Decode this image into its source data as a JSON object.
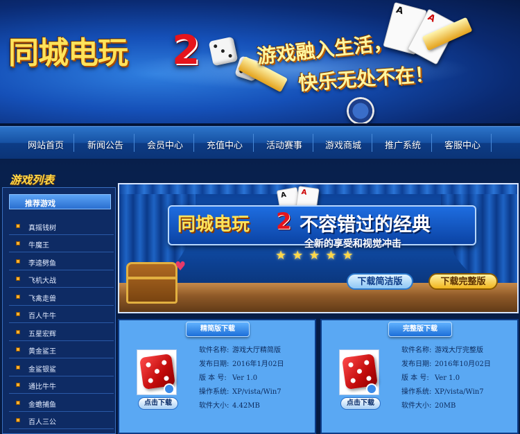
{
  "banner": {
    "logo_text": "同城电玩",
    "logo_num": "2",
    "slogan_line1": "游戏融入生活，",
    "slogan_line2": "快乐无处不在！"
  },
  "nav": {
    "items": [
      "网站首页",
      "新闻公告",
      "会员中心",
      "充值中心",
      "活动赛事",
      "游戏商城",
      "推广系统",
      "客服中心"
    ]
  },
  "sidebar": {
    "title": "游戏列表",
    "header": "推荐游戏",
    "items": [
      "真摇钱树",
      "牛魔王",
      "李逵劈鱼",
      "飞机大战",
      "飞禽走兽",
      "百人牛牛",
      "五星宏辉",
      "黄金鲨王",
      "金鲨银鲨",
      "通比牛牛",
      "金蟾捕鱼",
      "百人三公"
    ]
  },
  "promo": {
    "logo_text": "同城电玩",
    "logo_num": "2",
    "headline": "不容错过的经典",
    "subtitle": "全新的享受和视觉冲击",
    "stars": "★★★★★",
    "btn_lite": "下载简洁版",
    "btn_full": "下载完整版"
  },
  "downloads": [
    {
      "tab": "精简版下载",
      "button": "点击下载",
      "rows": [
        {
          "k": "软件名称:",
          "v": "游戏大厅精简版"
        },
        {
          "k": "发布日期:",
          "v": "2016年1月02日"
        },
        {
          "k": "版 本 号:",
          "v": "Ver 1.0"
        },
        {
          "k": "操作系统:",
          "v": "XP/vista/Win7"
        },
        {
          "k": "软件大小:",
          "v": "4.42MB"
        }
      ]
    },
    {
      "tab": "完整版下载",
      "button": "点击下载",
      "rows": [
        {
          "k": "软件名称:",
          "v": "游戏大厅完整版"
        },
        {
          "k": "发布日期:",
          "v": "2016年10月02日"
        },
        {
          "k": "版 本 号:",
          "v": "Ver 1.0"
        },
        {
          "k": "操作系统:",
          "v": "XP/vista/Win7"
        },
        {
          "k": "软件大小:",
          "v": "20MB"
        }
      ]
    }
  ]
}
